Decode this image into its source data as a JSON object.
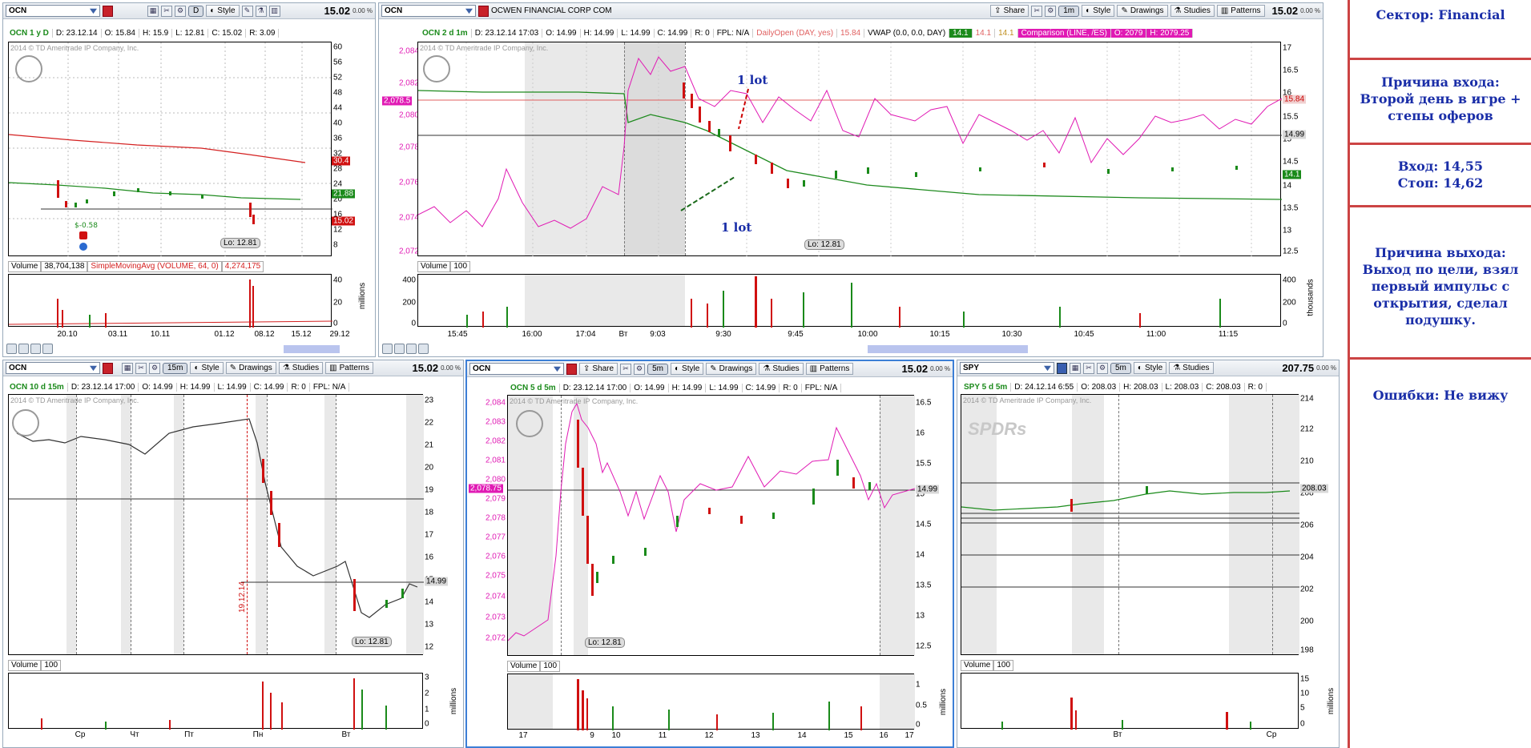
{
  "panels": {
    "p1": {
      "symbol": "OCN",
      "period": "D",
      "last": "15.02",
      "pct": "0.00 %",
      "style": "Style",
      "info": {
        "name": "OCN 1 y D",
        "d": "D: 23.12.14",
        "o": "O: 15.84",
        "h": "H: 15.9",
        "l": "L: 12.81",
        "c": "C: 15.02",
        "r": "R: 3.09"
      },
      "watermark": "2014 © TD Ameritrade IP Company, Inc.",
      "yticks": [
        "60",
        "56",
        "52",
        "48",
        "44",
        "40",
        "36",
        "32",
        "28",
        "24",
        "20",
        "16",
        "12",
        "8"
      ],
      "xticks": [
        "20.10",
        "03.11",
        "10.11",
        "01.12",
        "08.12",
        "15.12",
        "29.12"
      ],
      "tags": {
        "t1": "30.4",
        "t2": "21.88",
        "t3": "15.02"
      },
      "lo": "Lo: 12.81",
      "div": "$-0.58",
      "vol": {
        "label": "Volume",
        "value": "38,704,138",
        "sma": "SimpleMovingAvg (VOLUME, 64, 0)",
        "sma_val": "4,274,175",
        "ticks": [
          "40",
          "20",
          "0"
        ],
        "unit": "millions"
      }
    },
    "p2": {
      "symbol": "OCN",
      "company": "OCWEN FINANCIAL CORP COM",
      "period": "1m",
      "last": "15.02",
      "pct": "0.00 %",
      "share": "Share",
      "style": "Style",
      "drawings": "Drawings",
      "studies": "Studies",
      "patterns": "Patterns",
      "info": {
        "name": "OCN 2 d 1m",
        "d": "D: 23.12.14 17:03",
        "o": "O: 14.99",
        "h": "H: 14.99",
        "l": "L: 14.99",
        "c": "C: 14.99",
        "r": "R: 0",
        "fpl": "FPL: N/A",
        "daily": "DailyOpen (DAY, yes)",
        "daily_v": "15.84",
        "vwap": "VWAP (0.0, 0.0, DAY)",
        "v1": "14.1",
        "v2": "14.1",
        "v3": "14.1",
        "comp": "Comparison (LINE, /ES)",
        "co": "O: 2079",
        "ch": "H: 2079.25"
      },
      "watermark": "2014 © TD Ameritrade IP Company, Inc.",
      "yticks": [
        "17",
        "16.5",
        "16",
        "15.5",
        "15",
        "14.5",
        "14",
        "13.5",
        "13",
        "12.5"
      ],
      "lticks": [
        "2,084",
        "2,082",
        "2,080",
        "2,078",
        "2,076",
        "2,074",
        "2,072"
      ],
      "ltag": "2,078.5",
      "xticks": [
        "15:45",
        "16:00",
        "17:04",
        "Вт",
        "9:03",
        "9:30",
        "9:45",
        "10:00",
        "10:15",
        "10:30",
        "10:45",
        "11:00",
        "11:15"
      ],
      "tags": {
        "t1": "15.84",
        "t2": "14.99",
        "t3": "14.1"
      },
      "lo": "Lo: 12.81",
      "ann1": "1 lot",
      "ann2": "1 lot",
      "vol": {
        "label": "Volume",
        "value": "100",
        "ticks": [
          "400",
          "200",
          "0"
        ],
        "unit": "thousands"
      }
    },
    "p3": {
      "symbol": "OCN",
      "period": "15m",
      "last": "15.02",
      "pct": "0.00 %",
      "style": "Style",
      "drawings": "Drawings",
      "studies": "Studies",
      "patterns": "Patterns",
      "info": {
        "name": "OCN 10 d 15m",
        "d": "D: 23.12.14 17:00",
        "o": "O: 14.99",
        "h": "H: 14.99",
        "l": "L: 14.99",
        "c": "C: 14.99",
        "r": "R: 0",
        "fpl": "FPL: N/A"
      },
      "watermark": "2014 © TD Ameritrade IP Company, Inc.",
      "yticks": [
        "23",
        "22",
        "21",
        "20",
        "19",
        "18",
        "17",
        "16",
        "15",
        "14",
        "13",
        "12"
      ],
      "xticks": [
        "Ср",
        "Чт",
        "Пт",
        "Пн",
        "Вт"
      ],
      "tag": "14.99",
      "date": "19.12.14",
      "lo": "Lo: 12.81",
      "vol": {
        "label": "Volume",
        "value": "100",
        "ticks": [
          "3",
          "2",
          "1",
          "0"
        ],
        "unit": "millions"
      }
    },
    "p4": {
      "symbol": "OCN",
      "period": "5m",
      "last": "15.02",
      "pct": "0.00 %",
      "share": "Share",
      "style": "Style",
      "drawings": "Drawings",
      "studies": "Studies",
      "patterns": "Patterns",
      "info": {
        "name": "OCN 5 d 5m",
        "d": "D: 23.12.14 17:00",
        "o": "O: 14.99",
        "h": "H: 14.99",
        "l": "L: 14.99",
        "c": "C: 14.99",
        "r": "R: 0",
        "fpl": "FPL: N/A"
      },
      "watermark": "2014 © TD Ameritrade IP Company, Inc.",
      "yticks": [
        "16.5",
        "16",
        "15.5",
        "15",
        "14.5",
        "14",
        "13.5",
        "13",
        "12.5"
      ],
      "lticks": [
        "2,084",
        "2,083",
        "2,082",
        "2,081",
        "2,080",
        "2,079",
        "2,078",
        "2,077",
        "2,076",
        "2,075",
        "2,074",
        "2,073",
        "2,072"
      ],
      "ltag": "2,078.75",
      "xticks": [
        "17",
        "9",
        "10",
        "11",
        "12",
        "13",
        "14",
        "15",
        "16",
        "17"
      ],
      "tag": "14.99",
      "lo": "Lo: 12.81",
      "vol": {
        "label": "Volume",
        "value": "100",
        "ticks": [
          "1",
          "0.5",
          "0"
        ],
        "unit": "millions"
      }
    },
    "p5": {
      "symbol": "SPY",
      "period": "5m",
      "last": "207.75",
      "pct": "0.00 %",
      "style": "Style",
      "studies": "Studies",
      "info": {
        "name": "SPY 5 d 5m",
        "d": "D: 24.12.14 6:55",
        "o": "O: 208.03",
        "h": "H: 208.03",
        "l": "L: 208.03",
        "c": "C: 208.03",
        "r": "R: 0"
      },
      "watermark": "2014 © TD Ameritrade IP Company, Inc.",
      "brand": "SPDRs",
      "yticks": [
        "214",
        "212",
        "210",
        "208",
        "206",
        "204",
        "202",
        "200",
        "198"
      ],
      "xticks": [
        "Вт",
        "Ср"
      ],
      "tag": "208.03",
      "vol": {
        "label": "Volume",
        "value": "100",
        "ticks": [
          "15",
          "10",
          "5",
          "0"
        ],
        "unit": "millions"
      }
    }
  },
  "sidebar": {
    "sector": "Сектор: Financial",
    "entry_reason": "Причина входа: Второй день в игре + степы оферов",
    "entry": "Вход: 14,55",
    "stop": "Стоп: 14,62",
    "exit_reason": "Причина выхода: Выход по цели, взял первый импульс с открытия, сделал подушку.",
    "errors": "Ошибки: Не вижу"
  },
  "colors": {
    "up": "#1a8a1a",
    "down": "#d01010",
    "comparison": "#e01ab4",
    "vwap": "#1e8a1e",
    "sma": "#d42020",
    "sidebar_text": "#1a2ea8",
    "divider": "#c44"
  }
}
